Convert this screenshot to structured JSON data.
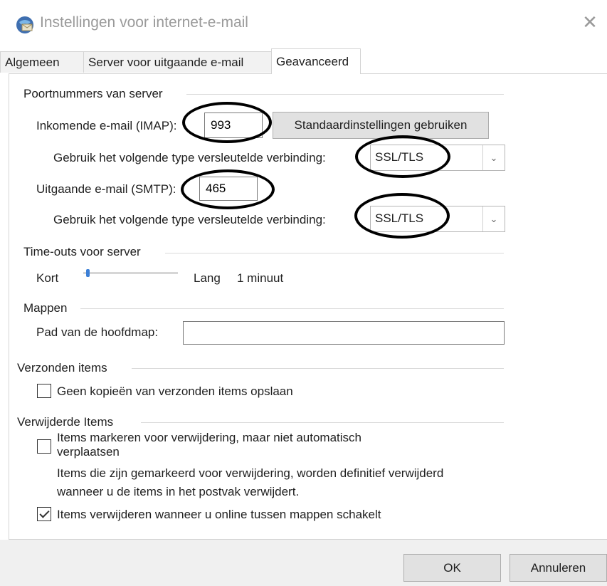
{
  "window": {
    "title": "Instellingen voor internet-e-mail",
    "close_symbol": "✕"
  },
  "tabs": [
    {
      "label": "Algemeen"
    },
    {
      "label": "Server voor uitgaande e-mail"
    },
    {
      "label": "Geavanceerd",
      "active": true
    }
  ],
  "ports": {
    "heading": "Poortnummers van server",
    "incoming_label": "Inkomende e-mail (IMAP):",
    "incoming_value": "993",
    "default_button": "Standaardinstellingen gebruiken",
    "incoming_encryption_label": "Gebruik het volgende type versleutelde verbinding:",
    "incoming_encryption_value": "SSL/TLS",
    "outgoing_label": "Uitgaande e-mail (SMTP):",
    "outgoing_value": "465",
    "outgoing_encryption_label": "Gebruik het volgende type versleutelde verbinding:",
    "outgoing_encryption_value": "SSL/TLS"
  },
  "timeouts": {
    "heading": "Time-outs voor server",
    "short_label": "Kort",
    "long_label": "Lang",
    "value_text": "1 minuut",
    "slider_level": 0.03
  },
  "folders": {
    "heading": "Mappen",
    "root_path_label": "Pad van de hoofdmap:",
    "root_path_value": ""
  },
  "sent": {
    "heading": "Verzonden items",
    "no_copies_label": "Geen kopieën van verzonden items opslaan",
    "no_copies_checked": false
  },
  "deleted": {
    "heading": "Verwijderde Items",
    "mark_label_line1": "Items markeren voor verwijdering, maar niet automatisch",
    "mark_label_line2": "verplaatsen",
    "mark_checked": false,
    "info_line1": "Items die zijn gemarkeerd voor verwijdering, worden definitief verwijderd",
    "info_line2": "wanneer u de items in het postvak verwijdert.",
    "purge_label": "Items verwijderen wanneer u online tussen mappen schakelt",
    "purge_checked": true
  },
  "footer": {
    "ok_label": "OK",
    "cancel_label": "Annuleren"
  },
  "colors": {
    "accent": "#3c7fd6",
    "annotation_circles": "#000000"
  },
  "icons": {
    "app": "globe-envelope-icon",
    "close": "close-icon",
    "dropdown": "chevron-down-icon",
    "check": "checkmark-icon"
  }
}
